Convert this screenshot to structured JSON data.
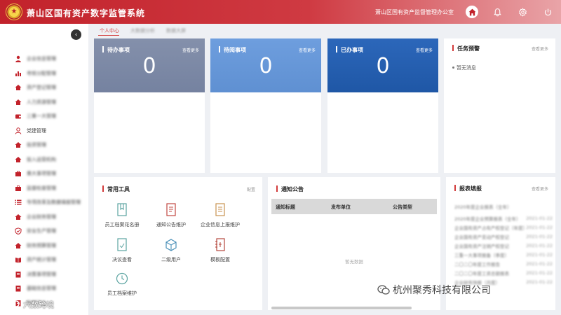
{
  "header": {
    "app_title": "萧山区国有资产数字监管系统",
    "org_name": "萧山区国有资产监督管理办公室",
    "icons": [
      "home-icon",
      "bell-icon",
      "gear-icon",
      "power-icon"
    ],
    "accent": "#c2222b"
  },
  "sidebar": {
    "items": [
      {
        "label": "企业信息管理",
        "icon": "person-icon"
      },
      {
        "label": "考核分配管理",
        "icon": "chart-icon"
      },
      {
        "label": "资产登记管理",
        "icon": "home-icon"
      },
      {
        "label": "人力资源管理",
        "icon": "home-icon"
      },
      {
        "label": "三重一大管理",
        "icon": "wallet-icon"
      },
      {
        "label": "党建管理",
        "icon": "user-icon"
      },
      {
        "label": "投资管理",
        "icon": "home-icon"
      },
      {
        "label": "投入运营机构",
        "icon": "home-icon"
      },
      {
        "label": "重大事项管理",
        "icon": "briefcase-icon"
      },
      {
        "label": "监督检查管理",
        "icon": "briefcase-icon"
      },
      {
        "label": "专项改革及数据填报管理",
        "icon": "list-icon"
      },
      {
        "label": "企业财务管理",
        "icon": "home-icon"
      },
      {
        "label": "安全生产管理",
        "icon": "shield-icon"
      },
      {
        "label": "财务预算管理",
        "icon": "home-icon"
      },
      {
        "label": "资产统计管理",
        "icon": "book-icon"
      },
      {
        "label": "决策事项管理",
        "icon": "doc-icon"
      },
      {
        "label": "基础信息管理",
        "icon": "doc-icon"
      },
      {
        "label": "数据平台",
        "icon": "doc-icon"
      }
    ]
  },
  "tabs": [
    {
      "label": "个人中心",
      "active": true
    },
    {
      "label": "大数据分析",
      "active": false
    },
    {
      "label": "数据大屏",
      "active": false
    }
  ],
  "stats": [
    {
      "title": "待办事项",
      "value": "0",
      "more": "查看更多",
      "color": "#7f8aa6"
    },
    {
      "title": "待阅事项",
      "value": "0",
      "more": "查看更多",
      "color": "#6a9ad8"
    },
    {
      "title": "已办事项",
      "value": "0",
      "more": "查看更多",
      "color": "#2761b3"
    }
  ],
  "task_alert": {
    "title": "任务预警",
    "more": "查看更多",
    "empty": "暂无消息"
  },
  "tools": {
    "title": "常用工具",
    "config": "配置",
    "items": [
      {
        "label": "员工档案花名册",
        "icon": "bookmark-icon"
      },
      {
        "label": "通知公告维护",
        "icon": "document-icon"
      },
      {
        "label": "企业信息上报维护",
        "icon": "form-icon"
      },
      {
        "label": "决议查看",
        "icon": "resolution-icon"
      },
      {
        "label": "二级用户",
        "icon": "cube-icon"
      },
      {
        "label": "模板配置",
        "icon": "template-icon"
      },
      {
        "label": "员工档案维护",
        "icon": "clock-icon"
      }
    ]
  },
  "notice": {
    "title": "通知公告",
    "columns": [
      "通知标题",
      "发布单位",
      "公告类型"
    ],
    "empty": "暂无数据"
  },
  "reports": {
    "title": "报表填报",
    "more": "查看更多",
    "rows": [
      {
        "title": "2020年度企业报表（全年）",
        "date": ""
      },
      {
        "title": "2020年度企业预算报表（全年）",
        "date": "2021-01-22"
      },
      {
        "title": "企业国有资产占有产权登记（年度）",
        "date": "2021-01-22"
      },
      {
        "title": "企业国有资产变动产权登记",
        "date": "2021-01-22"
      },
      {
        "title": "企业国有资产注销产权登记",
        "date": "2021-01-22"
      },
      {
        "title": "三重一大事项报备（季度）",
        "date": "2021-01-22"
      },
      {
        "title": "二〇二〇年度工作报告",
        "date": "2021-01-22"
      },
      {
        "title": "二〇二〇年度工资总额报表",
        "date": "2021-01-22"
      },
      {
        "title": "企业财务快报（月度）",
        "date": "2021-01-22"
      }
    ]
  },
  "watermarks": {
    "left": "六数跨境",
    "right": "杭州聚秀科技有限公司"
  }
}
